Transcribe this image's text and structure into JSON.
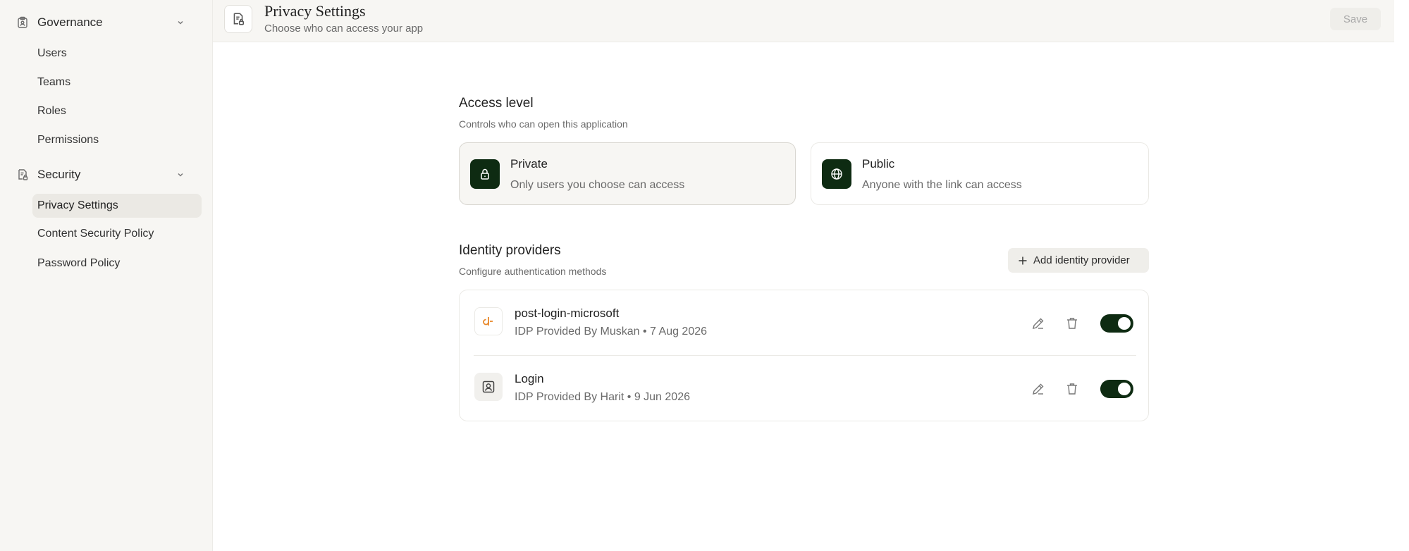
{
  "sidebar": {
    "groups": [
      {
        "label": "Governance",
        "icon": "clipboard-icon",
        "items": [
          "Users",
          "Teams",
          "Roles",
          "Permissions"
        ]
      },
      {
        "label": "Security",
        "icon": "document-lock-icon",
        "items": [
          "Privacy Settings",
          "Content Security Policy",
          "Password Policy"
        ]
      }
    ],
    "active_item": "Privacy Settings"
  },
  "header": {
    "title": "Privacy Settings",
    "subtitle": "Choose who can access your app",
    "save_label": "Save"
  },
  "access": {
    "title": "Access level",
    "subtitle": "Controls who can open this application",
    "options": [
      {
        "title": "Private",
        "description": "Only users you choose can access",
        "icon": "lock-icon",
        "selected": true
      },
      {
        "title": "Public",
        "description": "Anyone with the link can access",
        "icon": "globe-icon",
        "selected": false
      }
    ]
  },
  "identity": {
    "title": "Identity providers",
    "subtitle": "Configure authentication methods",
    "add_label": "Add identity provider",
    "providers": [
      {
        "name": "post-login-microsoft",
        "meta": "IDP Provided By Muskan • 7 Aug 2026",
        "icon": "provider-logo-icon",
        "enabled": true
      },
      {
        "name": "Login",
        "meta": "IDP Provided By Harit • 9 Jun 2026",
        "icon": "user-card-icon",
        "enabled": true
      }
    ]
  },
  "colors": {
    "accent": "#0e2b12",
    "sidebar_bg": "#f7f6f3",
    "active_bg": "#ebe9e4",
    "logo_orange": "#e8892b"
  }
}
